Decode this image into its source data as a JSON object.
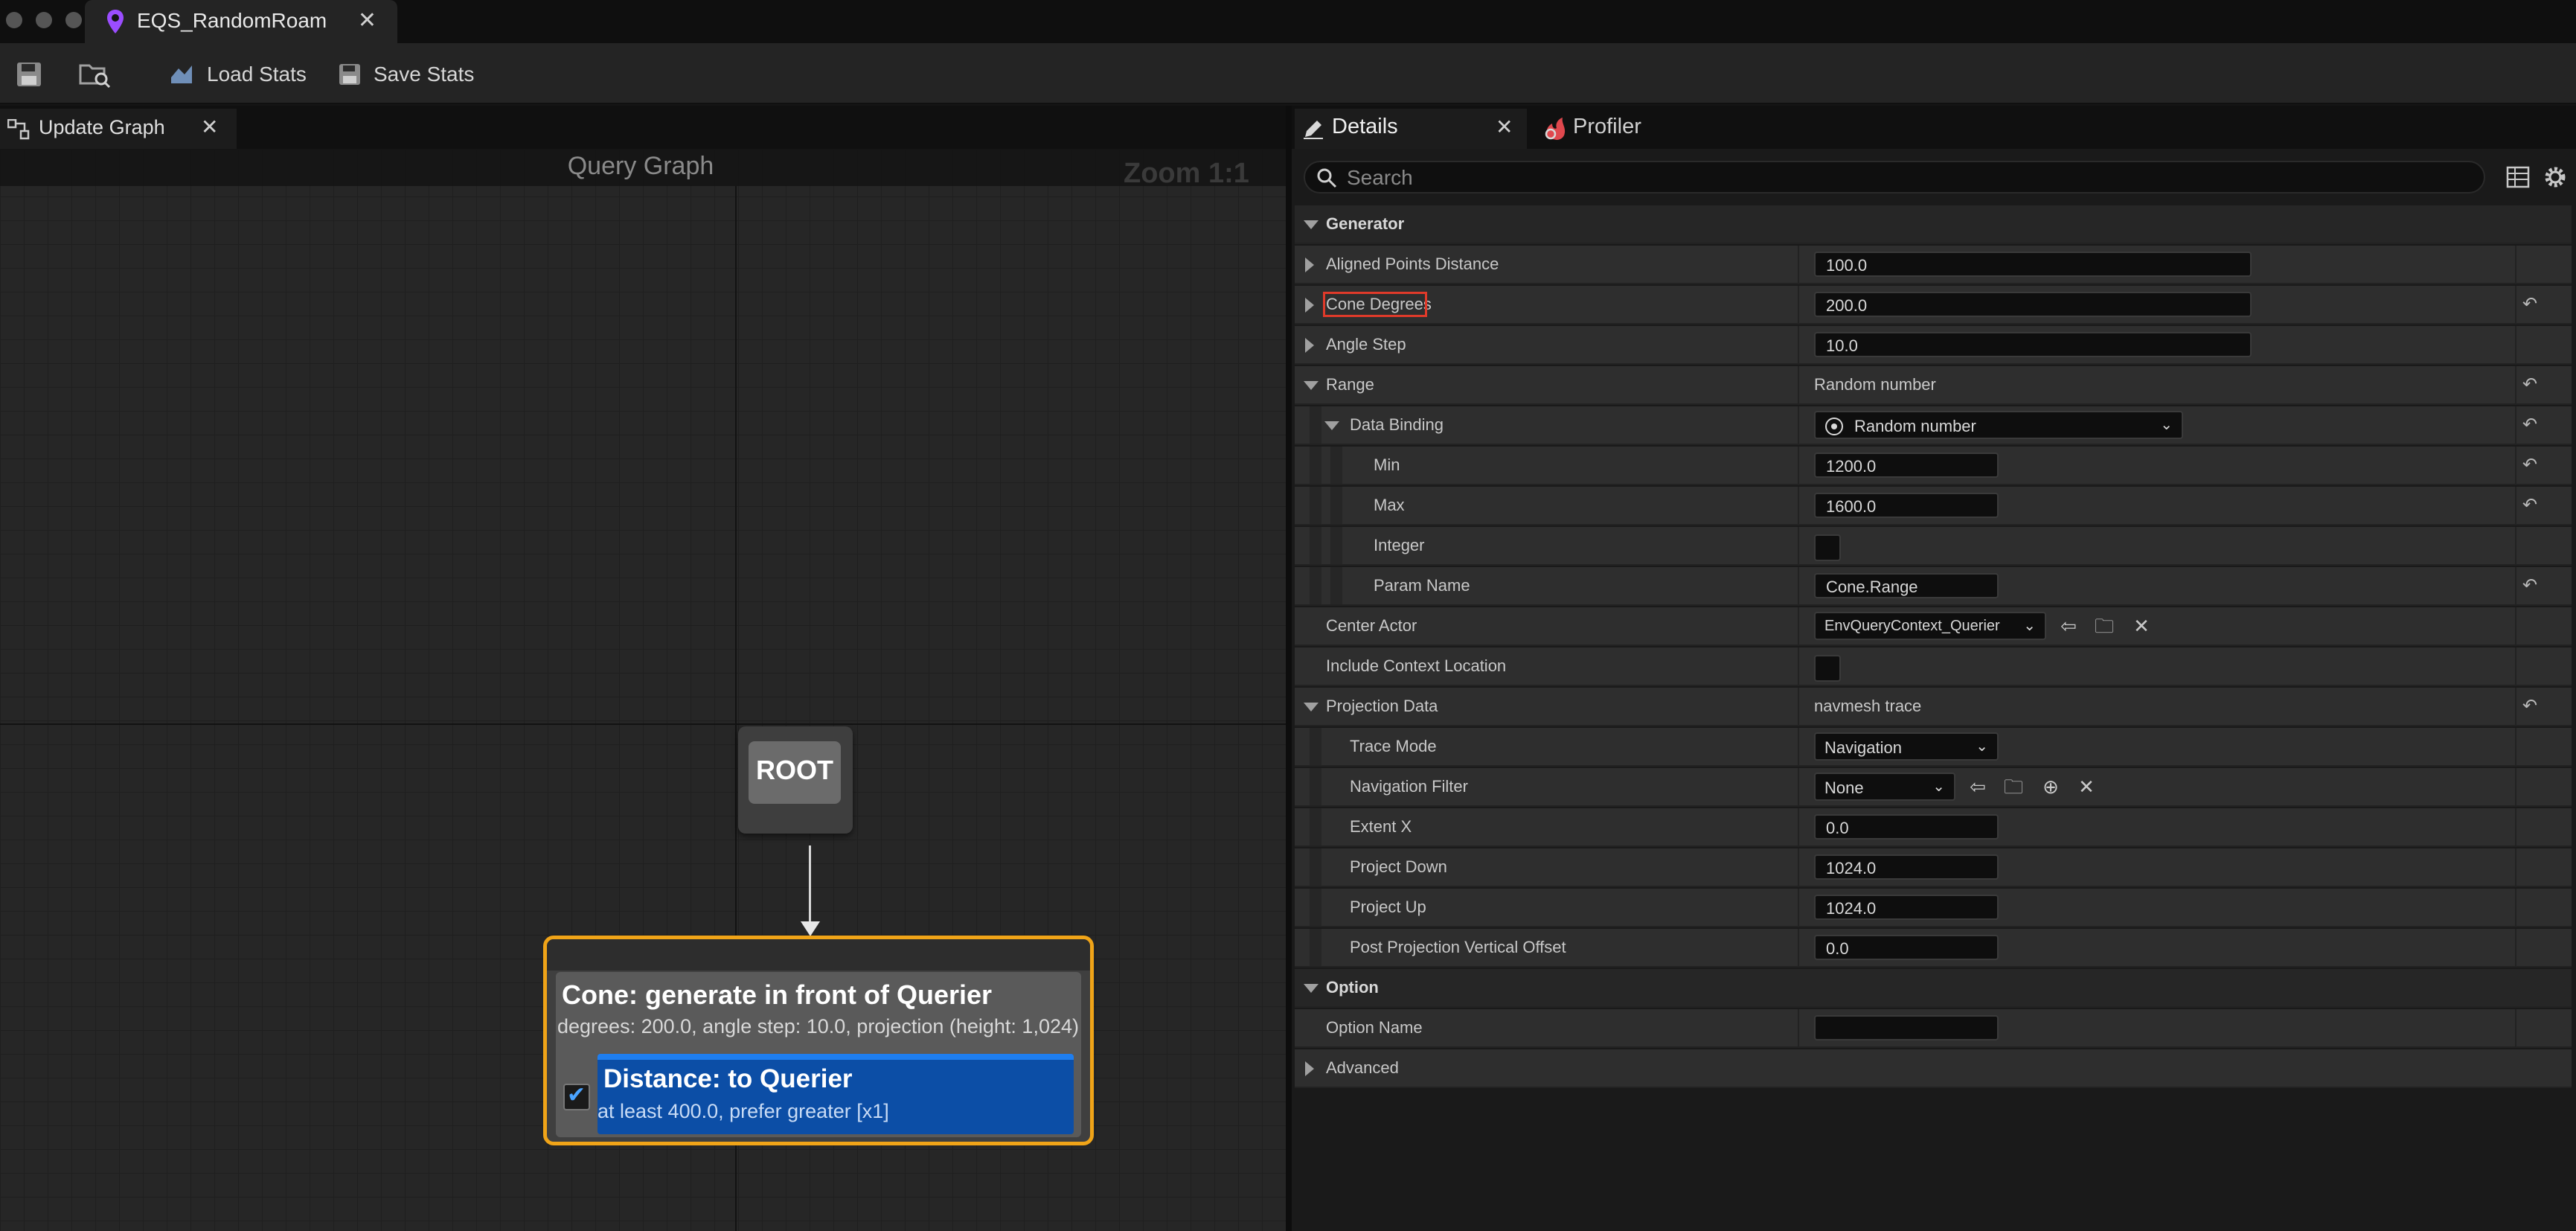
{
  "window": {
    "doc_tab_title": "EQS_RandomRoam"
  },
  "toolbar": {
    "load_label": "Load Stats",
    "save_label": "Save Stats"
  },
  "left_panel": {
    "tab_label": "Update Graph",
    "graph_title": "Query Graph",
    "zoom": "Zoom 1:1",
    "root_label": "ROOT",
    "cone_node": {
      "title": "Cone: generate in front of Querier",
      "description": "degrees: 200.0, angle step: 10.0, projection (height: 1,024)",
      "test": {
        "title": "Distance: to Querier",
        "description": "at least 400.0, prefer greater [x1]"
      }
    }
  },
  "right_panel": {
    "tabs": [
      "Details",
      "Profiler"
    ],
    "search_placeholder": "Search",
    "properties": [
      {
        "label": "Generator"
      },
      {
        "label": "Aligned Points Distance",
        "value": "100.0"
      },
      {
        "label": "Cone Degrees",
        "value": "200.0"
      },
      {
        "label": "Angle Step",
        "value": "10.0"
      },
      {
        "label": "Range",
        "value": "Random number"
      },
      {
        "label": "Data Binding",
        "value": "Random number"
      },
      {
        "label": "Min",
        "value": "1200.0"
      },
      {
        "label": "Max",
        "value": "1600.0"
      },
      {
        "label": "Integer"
      },
      {
        "label": "Param Name",
        "value": "Cone.Range"
      },
      {
        "label": "Center Actor",
        "value": "EnvQueryContext_Querier"
      },
      {
        "label": "Include Context Location"
      },
      {
        "label": "Projection Data",
        "value": "navmesh trace"
      },
      {
        "label": "Trace Mode",
        "value": "Navigation"
      },
      {
        "label": "Navigation Filter",
        "value": "None"
      },
      {
        "label": "Extent X",
        "value": "0.0"
      },
      {
        "label": "Project Down",
        "value": "1024.0"
      },
      {
        "label": "Project Up",
        "value": "1024.0"
      },
      {
        "label": "Post Projection Vertical Offset",
        "value": "0.0"
      },
      {
        "label": "Option"
      },
      {
        "label": "Option Name",
        "value": ""
      },
      {
        "label": "Advanced"
      }
    ]
  },
  "colors": {
    "selection_outline": "#f0a418",
    "highlight_box": "#e03a2a",
    "test_blue": "#0c4ea6"
  }
}
